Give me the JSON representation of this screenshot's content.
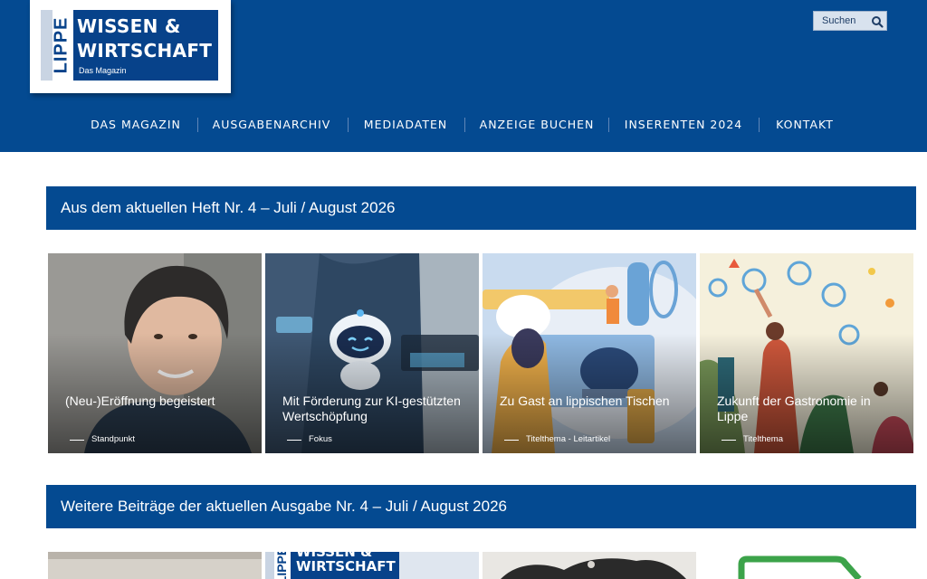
{
  "logo": {
    "vertical_text": "LIPPE",
    "line1": "WISSEN &",
    "line2": "WIRTSCHAFT",
    "subtitle": "Das Magazin"
  },
  "search": {
    "label": "Suchen",
    "icon": "search-icon"
  },
  "nav": {
    "items": [
      {
        "label": "DAS MAGAZIN"
      },
      {
        "label": "AUSGABENARCHIV"
      },
      {
        "label": "MEDIADATEN"
      },
      {
        "label": "ANZEIGE BUCHEN"
      },
      {
        "label": "INSERENTEN 2024"
      },
      {
        "label": "KONTAKT"
      }
    ]
  },
  "current_issue": {
    "heading": "Aus dem aktuellen Heft Nr. 4 – Juli / August 2026",
    "cards": [
      {
        "title": "(Neu-)Eröffnung begeistert",
        "category": "Standpunkt"
      },
      {
        "title": "Mit Förderung zur KI-gestützten Wertschöpfung",
        "category": "Fokus"
      },
      {
        "title": "Zu Gast an lippischen Tischen",
        "category": "Titelthema - Leitartikel"
      },
      {
        "title": "Zukunft der Gastronomie in Lippe",
        "category": "Titelthema"
      }
    ]
  },
  "more_articles": {
    "heading": "Weitere Beiträge der aktuellen Ausgabe Nr. 4 – Juli / August 2026",
    "thumb_logo_line1": "WISSEN &",
    "thumb_logo_line2": "WIRTSCHAFT",
    "thumb_logo_vertical": "LIPPE"
  },
  "colors": {
    "brand_blue": "#044a91",
    "white": "#ffffff"
  }
}
